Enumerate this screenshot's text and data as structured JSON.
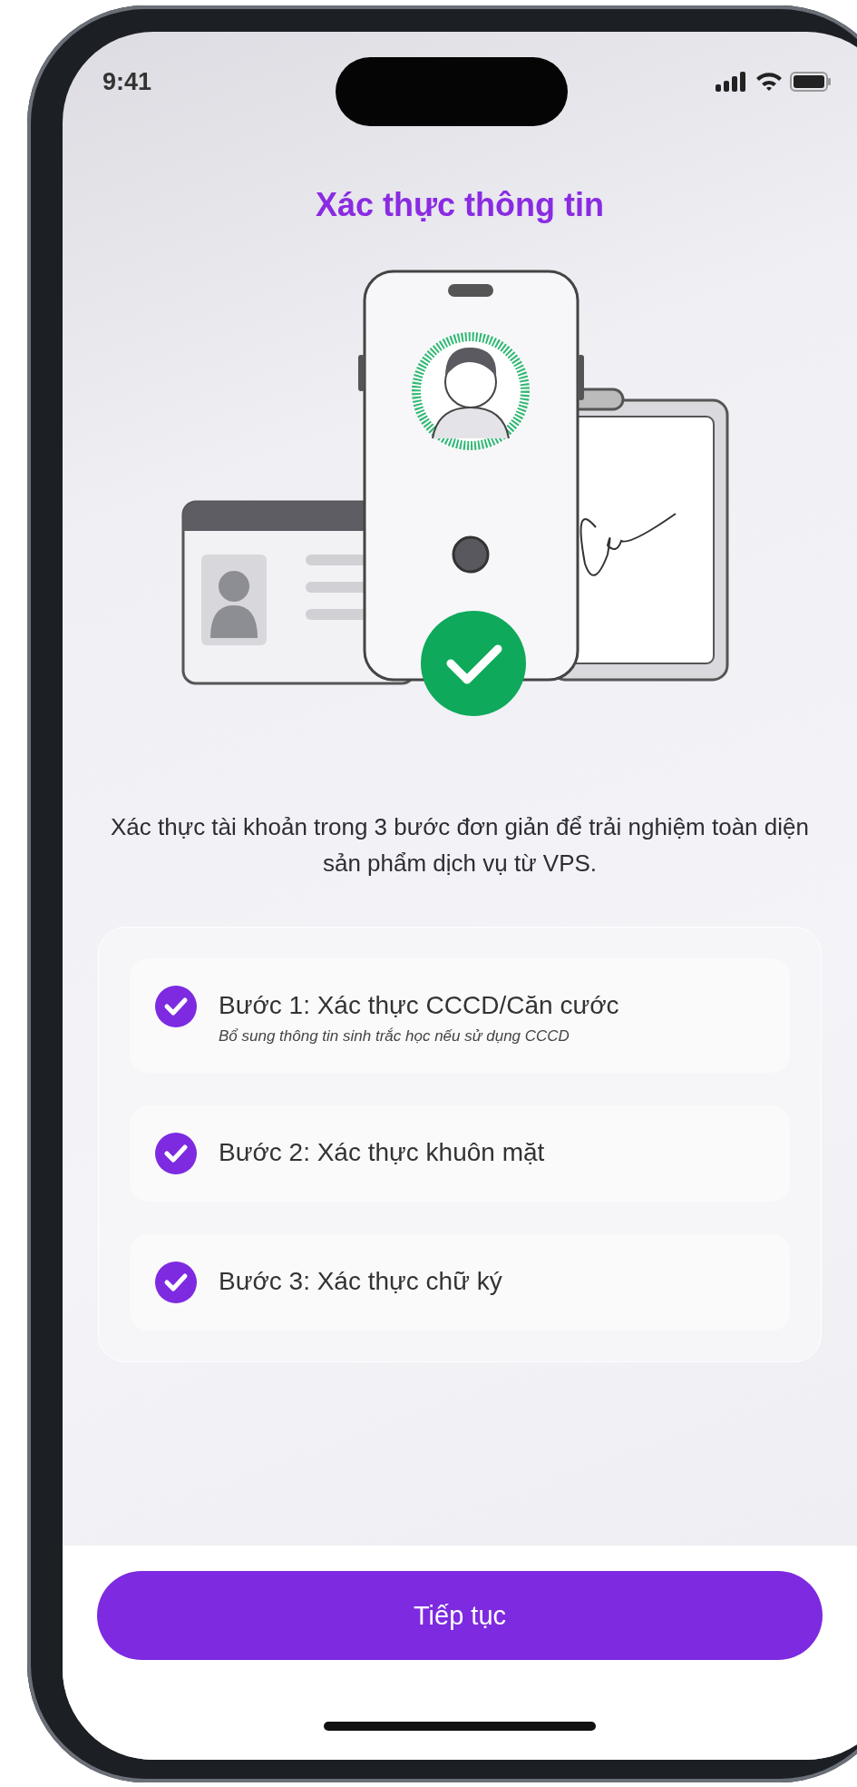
{
  "status_bar": {
    "time": "9:41"
  },
  "title": "Xác thực thông tin",
  "description": "Xác thực tài khoản trong 3 bước đơn giản để trải nghiệm toàn diện sản phẩm dịch vụ từ VPS.",
  "steps": [
    {
      "title": "Bước 1: Xác thực CCCD/Căn cước",
      "subtitle": "Bổ sung thông tin sinh trắc học nếu sử dụng CCCD",
      "checked": true
    },
    {
      "title": "Bước 2: Xác thực khuôn mặt",
      "checked": true
    },
    {
      "title": "Bước 3: Xác thực chữ ký",
      "checked": true
    }
  ],
  "button": "Tiếp tục"
}
